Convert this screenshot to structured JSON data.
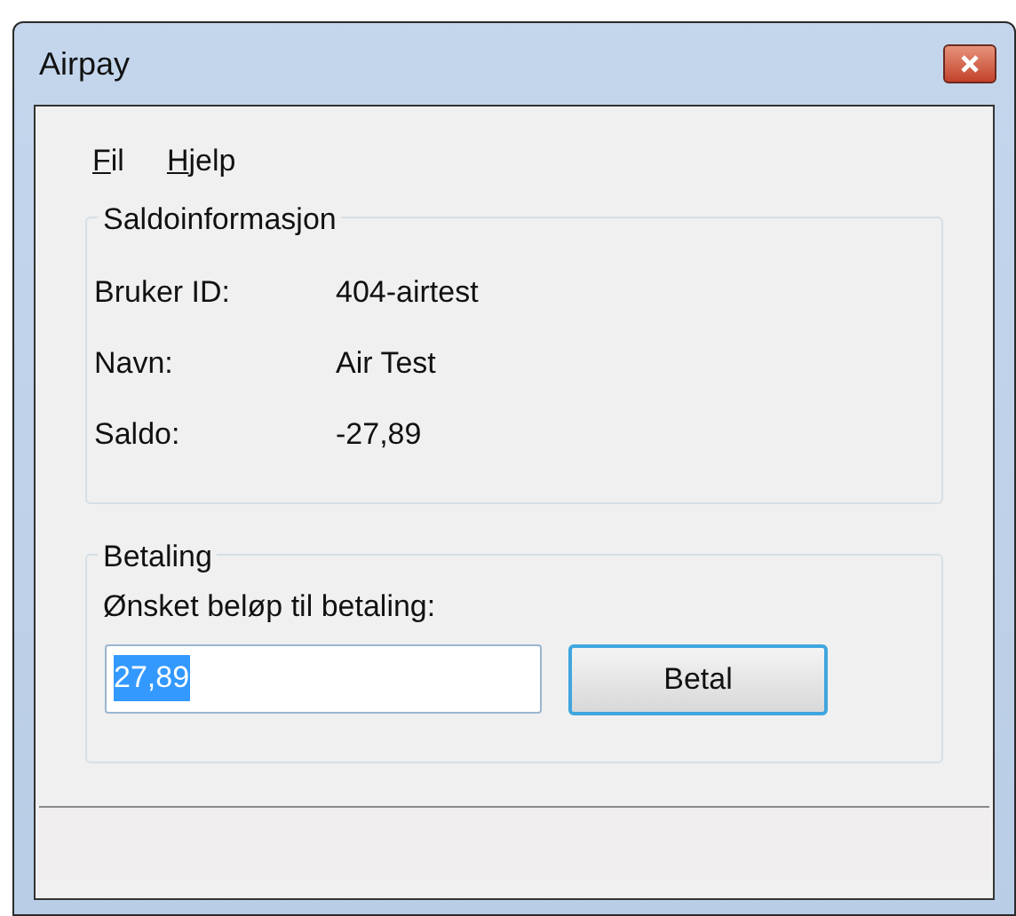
{
  "window": {
    "title": "Airpay"
  },
  "menu": [
    {
      "label": "Fil"
    },
    {
      "label": "Hjelp"
    }
  ],
  "balance_group": {
    "title": "Saldoinformasjon",
    "rows": [
      {
        "label": "Bruker ID:",
        "value": "404-airtest"
      },
      {
        "label": "Navn:",
        "value": "Air Test"
      },
      {
        "label": "Saldo:",
        "value": "-27,89"
      }
    ]
  },
  "payment_group": {
    "title": "Betaling",
    "label": "Ønsket beløp til betaling:",
    "amount": {
      "value": "27,89",
      "selected": true
    },
    "button": "Betal"
  }
}
